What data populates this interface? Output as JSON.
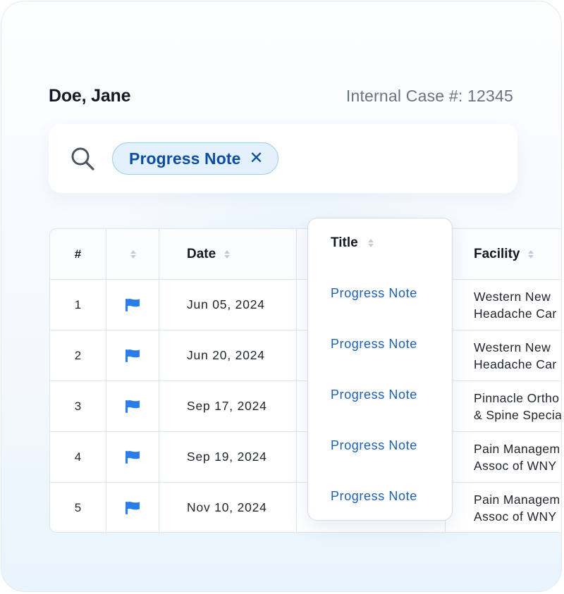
{
  "patient": {
    "name": "Doe, Jane",
    "case_label": "Internal Case #:",
    "case_number": "12345"
  },
  "search": {
    "filter_chip": "Progress Note",
    "chip_close": "✕"
  },
  "table": {
    "columns": {
      "index": "#",
      "flag": "",
      "date": "Date",
      "title": "Title",
      "facility": "Facility"
    },
    "rows": [
      {
        "num": "1",
        "date": "Jun 05, 2024",
        "title": "Progress Note",
        "facility_line1": "Western New",
        "facility_line2": "Headache Car"
      },
      {
        "num": "2",
        "date": "Jun 20, 2024",
        "title": "Progress Note",
        "facility_line1": "Western New",
        "facility_line2": "Headache Car"
      },
      {
        "num": "3",
        "date": "Sep 17, 2024",
        "title": "Progress Note",
        "facility_line1": "Pinnacle Ortho",
        "facility_line2": "& Spine Specia"
      },
      {
        "num": "4",
        "date": "Sep 19, 2024",
        "title": "Progress Note",
        "facility_line1": "Pain Managem",
        "facility_line2": "Assoc of WNY"
      },
      {
        "num": "5",
        "date": "Nov 10, 2024",
        "title": "Progress Note",
        "facility_line1": "Pain Managem",
        "facility_line2": "Assoc of WNY"
      }
    ]
  },
  "colors": {
    "accent": "#1d5fb0",
    "flag": "#2b7de9",
    "chip_bg": "#e3f1fc",
    "chip_border": "#9fcdf0"
  }
}
